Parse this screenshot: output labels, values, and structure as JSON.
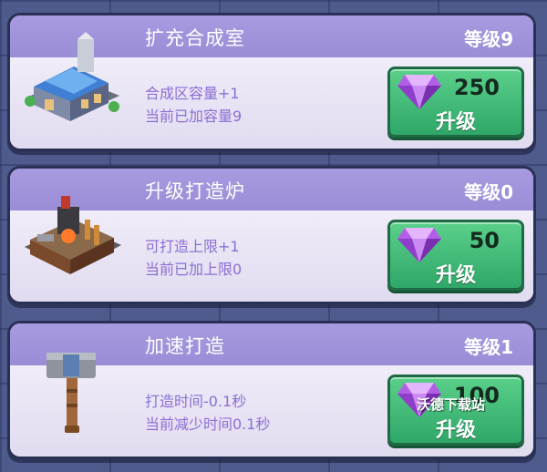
{
  "cards": [
    {
      "title": "扩充合成室",
      "level": "等级9",
      "desc1": "合成区容量+1",
      "desc2": "当前已加容量9",
      "price": "250",
      "button_label": "升级",
      "art_icon": "building-icon"
    },
    {
      "title": "升级打造炉",
      "level": "等级0",
      "desc1": "可打造上限+1",
      "desc2": "当前已加上限0",
      "price": "50",
      "button_label": "升级",
      "art_icon": "forge-icon"
    },
    {
      "title": "加速打造",
      "level": "等级1",
      "desc1": "打造时间-0.1秒",
      "desc2": "当前减少时间0.1秒",
      "price": "100",
      "button_label": "升级",
      "art_icon": "hammer-icon"
    }
  ],
  "currency_icon": "purple-gem-icon",
  "watermark": "沃德下载站",
  "colors": {
    "header": "#9a8cd6",
    "body": "#e9e4f4",
    "desc_text": "#8a6fd4",
    "button": "#3db874",
    "gem": "#b05ae0"
  }
}
